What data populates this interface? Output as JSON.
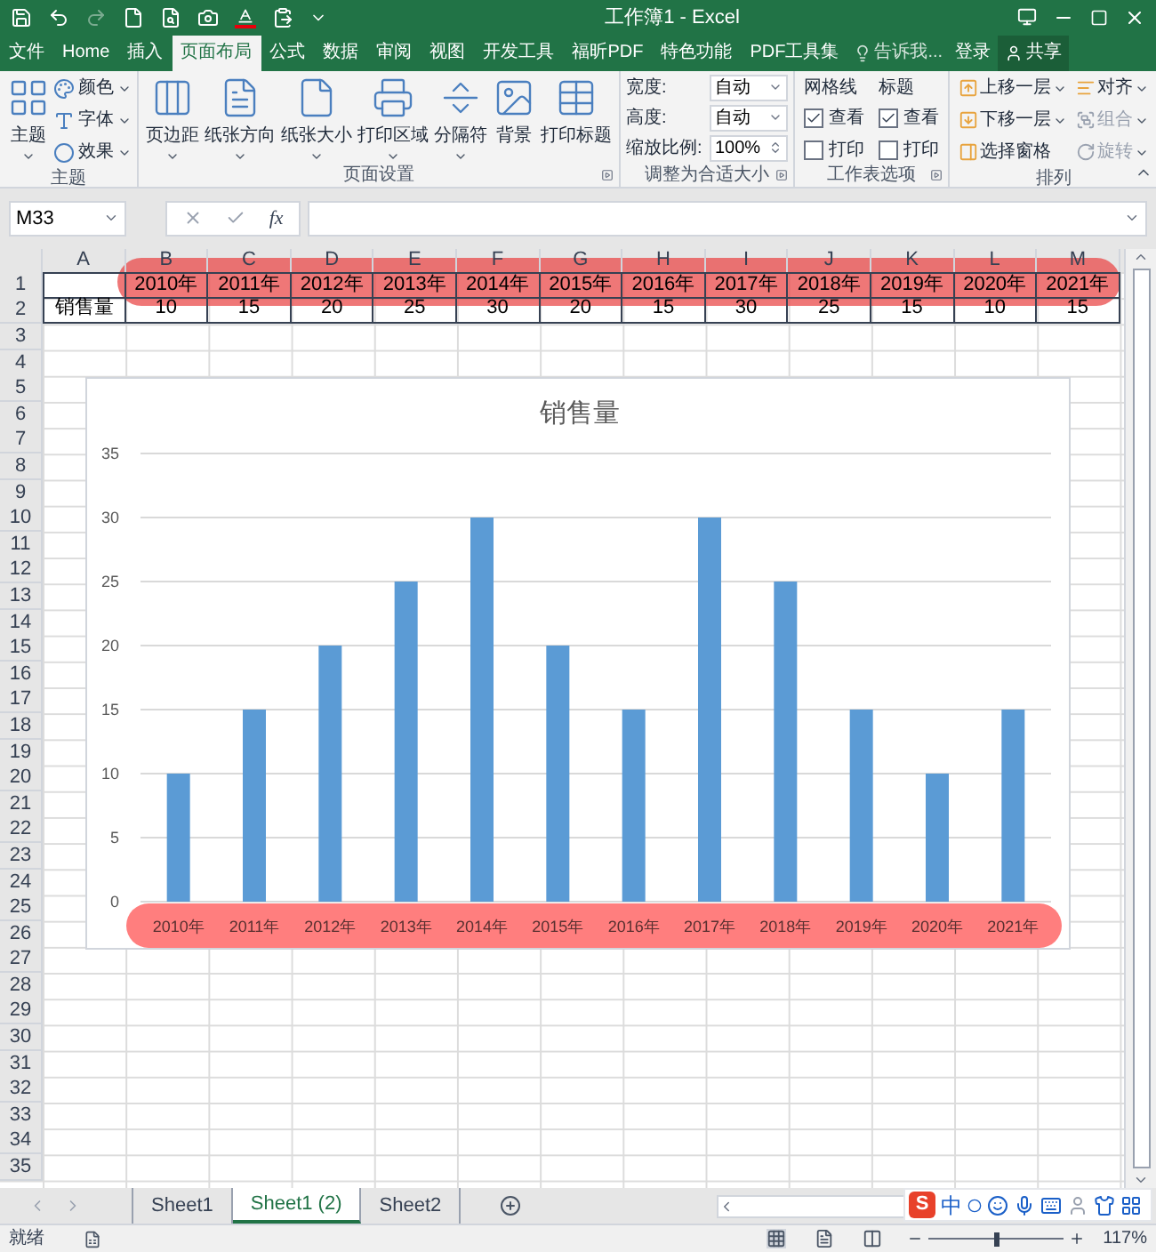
{
  "window": {
    "title": "工作簿1 - Excel"
  },
  "ribbon_tabs": [
    {
      "label": "文件",
      "selected": false
    },
    {
      "label": "Home",
      "selected": false
    },
    {
      "label": "插入",
      "selected": false
    },
    {
      "label": "页面布局",
      "selected": true
    },
    {
      "label": "公式",
      "selected": false
    },
    {
      "label": "数据",
      "selected": false
    },
    {
      "label": "审阅",
      "selected": false
    },
    {
      "label": "视图",
      "selected": false
    },
    {
      "label": "开发工具",
      "selected": false
    },
    {
      "label": "福昕PDF",
      "selected": false
    },
    {
      "label": "特色功能",
      "selected": false
    },
    {
      "label": "PDF工具集",
      "selected": false
    }
  ],
  "tell_me": "告诉我...",
  "sign_in": "登录",
  "share": "共享",
  "ribbon_groups": [
    {
      "kind": "buttons",
      "label": "主题",
      "launcher": false,
      "items": [
        {
          "kind": "large",
          "label": "主题",
          "dropdown": true
        },
        {
          "kind": "small",
          "label": "颜色",
          "dropdown": true
        },
        {
          "kind": "small",
          "label": "字体",
          "dropdown": true
        },
        {
          "kind": "small",
          "label": "效果",
          "dropdown": true
        }
      ]
    },
    {
      "kind": "buttons",
      "label": "页面设置",
      "launcher": true,
      "items": [
        {
          "kind": "large",
          "label": "页边距",
          "dropdown": true
        },
        {
          "kind": "large",
          "label": "纸张方向",
          "dropdown": true
        },
        {
          "kind": "large",
          "label": "纸张大小",
          "dropdown": true
        },
        {
          "kind": "large",
          "label": "打印区域",
          "dropdown": true
        },
        {
          "kind": "large",
          "label": "分隔符",
          "dropdown": true
        },
        {
          "kind": "large",
          "label": "背景",
          "dropdown": false
        },
        {
          "kind": "large",
          "label": "打印标题",
          "dropdown": false
        }
      ]
    },
    {
      "kind": "scale",
      "label": "调整为合适大小",
      "launcher": true,
      "fields": [
        {
          "kind": "select",
          "label": "宽度:",
          "value": "自动"
        },
        {
          "kind": "select",
          "label": "高度:",
          "value": "自动"
        },
        {
          "kind": "spin",
          "label": "缩放比例:",
          "value": "100%"
        }
      ]
    },
    {
      "kind": "sheet_options",
      "label": "工作表选项",
      "launcher": true,
      "columns": [
        {
          "heading": "网格线",
          "options": [
            {
              "label": "查看",
              "checked": true
            },
            {
              "label": "打印",
              "checked": false
            }
          ]
        },
        {
          "heading": "标题",
          "options": [
            {
              "label": "查看",
              "checked": true
            },
            {
              "label": "打印",
              "checked": false
            }
          ]
        }
      ]
    },
    {
      "kind": "arrange",
      "label": "排列",
      "launcher": false,
      "items": [
        {
          "label": "上移一层",
          "dropdown": true,
          "disabled": false
        },
        {
          "label": "下移一层",
          "dropdown": true,
          "disabled": false
        },
        {
          "label": "选择窗格",
          "dropdown": false,
          "disabled": false
        },
        {
          "label": "对齐",
          "dropdown": true,
          "disabled": false
        },
        {
          "label": "组合",
          "dropdown": true,
          "disabled": true
        },
        {
          "label": "旋转",
          "dropdown": true,
          "disabled": true
        }
      ]
    }
  ],
  "formula_bar": {
    "name_box": "M33",
    "fx": "fx"
  },
  "sheet": {
    "columns": [
      "A",
      "B",
      "C",
      "D",
      "E",
      "F",
      "G",
      "H",
      "I",
      "J",
      "K",
      "L",
      "M"
    ],
    "rows": [
      {
        "header": "1",
        "cells": [
          null,
          "2010年",
          "2011年",
          "2012年",
          "2013年",
          "2014年",
          "2015年",
          "2016年",
          "2017年",
          "2018年",
          "2019年",
          "2020年",
          "2021年"
        ]
      },
      {
        "header": "2",
        "cells": [
          "销售量",
          "10",
          "15",
          "20",
          "25",
          "30",
          "20",
          "15",
          "30",
          "25",
          "15",
          "10",
          "15"
        ]
      },
      {
        "header": "3"
      },
      {
        "header": "4"
      },
      {
        "header": "5"
      },
      {
        "header": "6"
      },
      {
        "header": "7"
      },
      {
        "header": "8"
      },
      {
        "header": "9"
      },
      {
        "header": "10"
      },
      {
        "header": "11"
      },
      {
        "header": "12"
      },
      {
        "header": "13"
      },
      {
        "header": "14"
      },
      {
        "header": "15"
      },
      {
        "header": "16"
      },
      {
        "header": "17"
      },
      {
        "header": "18"
      },
      {
        "header": "19"
      },
      {
        "header": "20"
      },
      {
        "header": "21"
      },
      {
        "header": "22"
      },
      {
        "header": "23"
      },
      {
        "header": "24"
      },
      {
        "header": "25"
      },
      {
        "header": "26"
      },
      {
        "header": "27"
      },
      {
        "header": "28"
      },
      {
        "header": "29"
      },
      {
        "header": "30"
      },
      {
        "header": "31"
      },
      {
        "header": "32"
      },
      {
        "header": "33"
      },
      {
        "header": "34"
      },
      {
        "header": "35"
      }
    ]
  },
  "chart": {
    "chart_data": {
      "type": "bar",
      "title": "销售量",
      "categories": [
        "2010年",
        "2011年",
        "2012年",
        "2013年",
        "2014年",
        "2015年",
        "2016年",
        "2017年",
        "2018年",
        "2019年",
        "2020年",
        "2021年"
      ],
      "grid": true,
      "series": [
        {
          "color": "#5b9bd5",
          "values": [
            10,
            15,
            20,
            25,
            30,
            20,
            15,
            30,
            25,
            15,
            10,
            15
          ]
        }
      ],
      "ylim": [
        0,
        35
      ],
      "yticks": [
        0,
        5,
        10,
        15,
        20,
        25,
        30,
        35
      ]
    }
  },
  "sheet_tabs": [
    {
      "label": "Sheet1",
      "selected": false
    },
    {
      "label": "Sheet1 (2)",
      "selected": true
    },
    {
      "label": "Sheet2",
      "selected": false
    }
  ],
  "ime_toolbar": {
    "logo": "S",
    "mode": "中"
  },
  "status_bar": {
    "status": "就绪",
    "zoom": {
      "level": 0.5,
      "reading": "117%"
    }
  }
}
